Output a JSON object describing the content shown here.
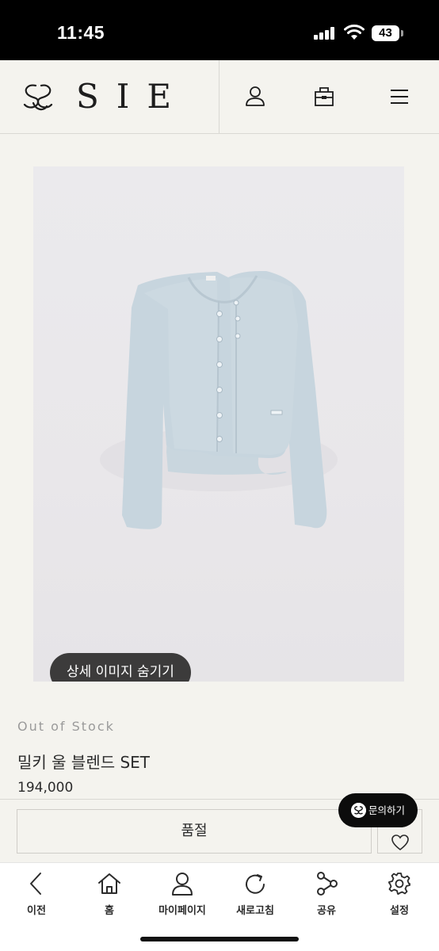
{
  "status_bar": {
    "time": "11:45",
    "battery": "43",
    "icons": [
      "signal-icon",
      "wifi-icon",
      "battery-icon"
    ]
  },
  "header": {
    "brand_name": "SIE",
    "icons": [
      "brand-logo-icon",
      "user-icon",
      "shopping-bag-icon",
      "menu-icon"
    ]
  },
  "product": {
    "image_icon": "cardigan-set-photo",
    "hide_detail_label": "상세 이미지 숨기기",
    "stock_status": "Out of Stock",
    "name": "밀키 울 블렌드 SET",
    "price": "194,000"
  },
  "actions": {
    "soldout_label": "품절",
    "inquiry_label": "문의하기",
    "wishlist_icon": "heart-icon"
  },
  "bottom_nav": {
    "items": [
      {
        "label": "이전",
        "icon": "back-arrow-icon"
      },
      {
        "label": "홈",
        "icon": "home-icon"
      },
      {
        "label": "마이페이지",
        "icon": "user-icon"
      },
      {
        "label": "새로고침",
        "icon": "refresh-icon"
      },
      {
        "label": "공유",
        "icon": "share-icon"
      },
      {
        "label": "설정",
        "icon": "gear-icon"
      }
    ]
  },
  "colors": {
    "background": "#f4f3ee",
    "status_bar": "#000000",
    "button_dark": "#3c3b3b",
    "inquiry_bg": "#0c0c0c",
    "muted_text": "#9a9a9a"
  }
}
